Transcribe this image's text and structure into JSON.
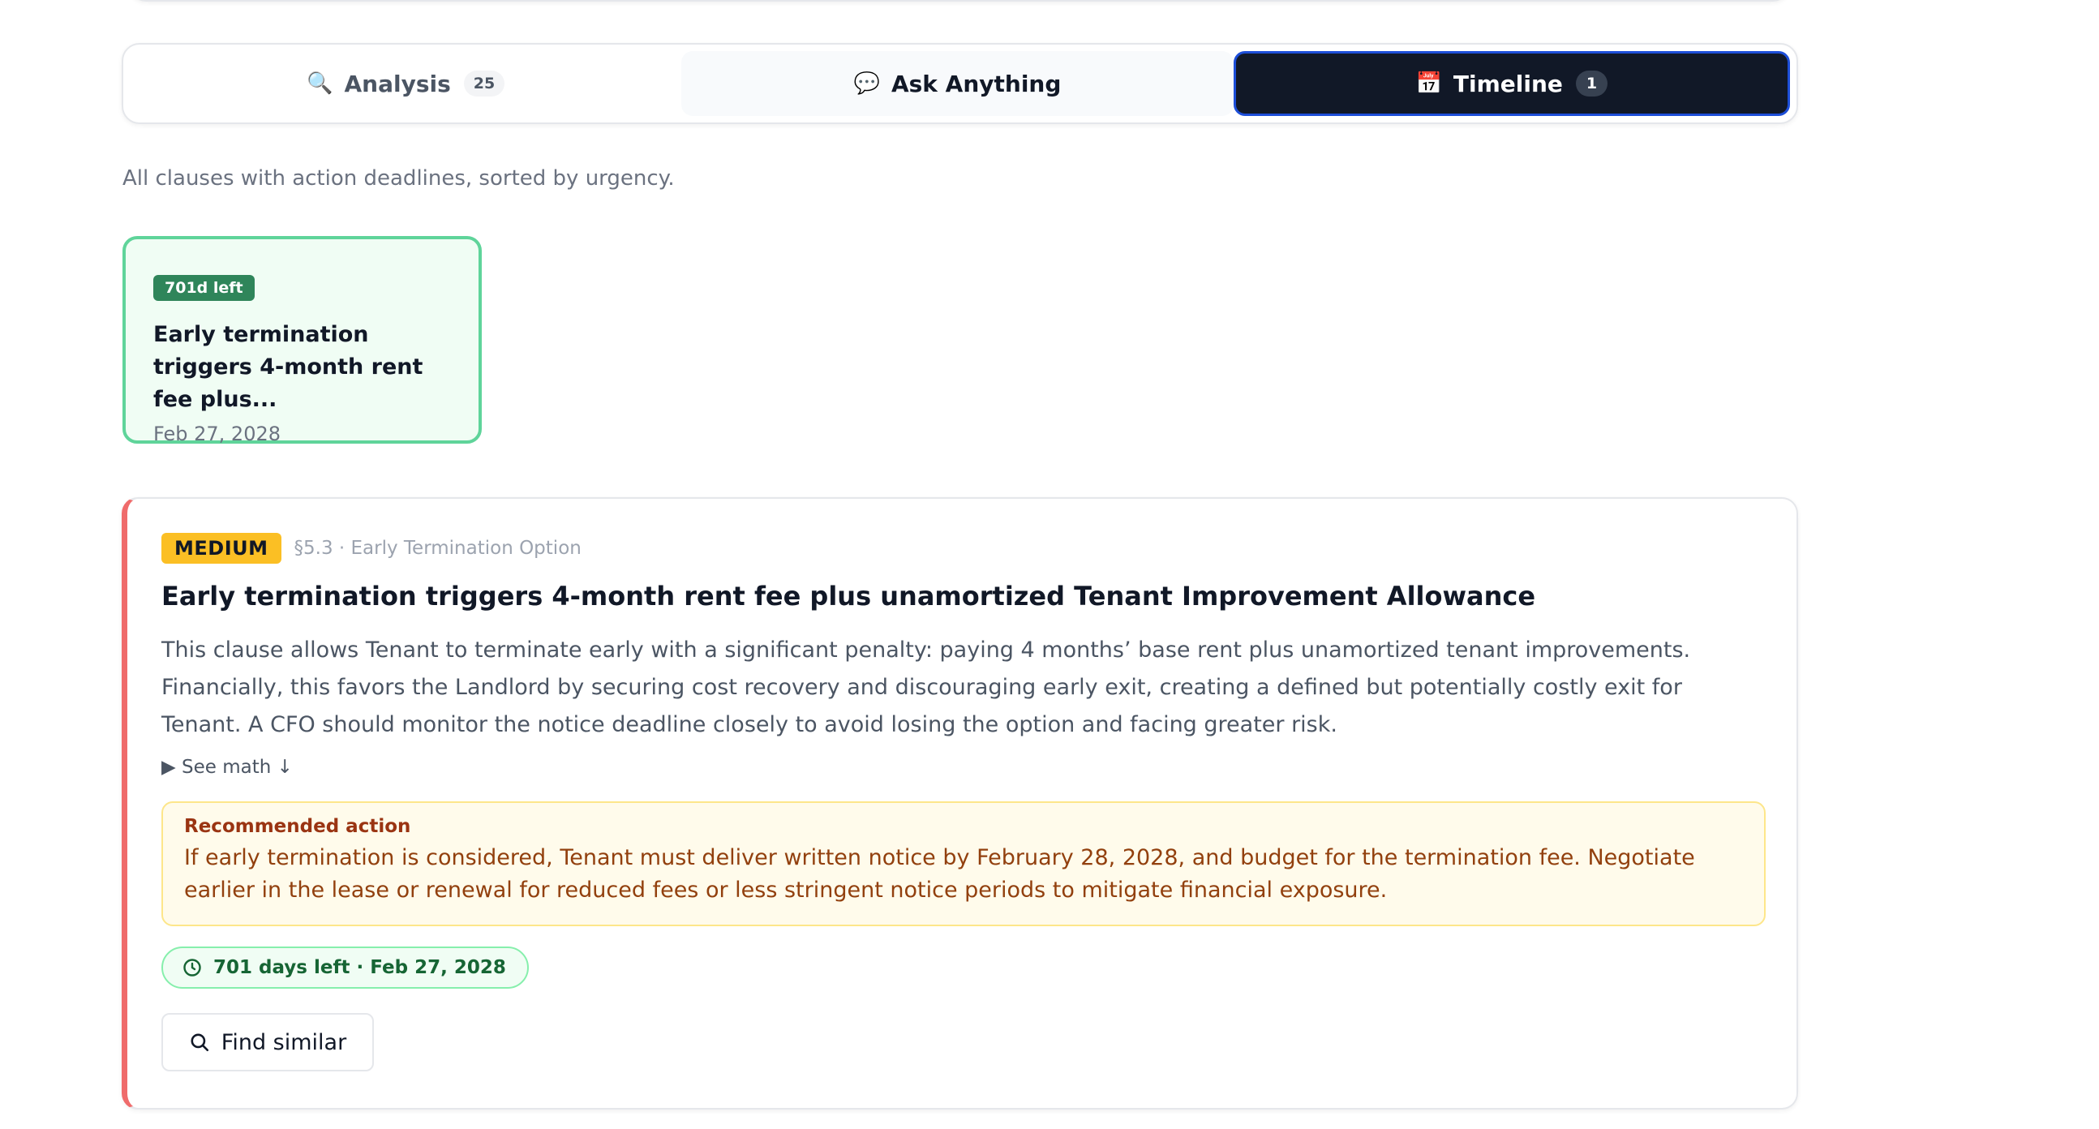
{
  "tabs": [
    {
      "label": "Analysis",
      "icon": "magnifier-icon",
      "count": "25"
    },
    {
      "label": "Ask Anything",
      "icon": "speech-bubble-icon"
    },
    {
      "label": "Timeline",
      "icon": "calendar-icon",
      "count": "1",
      "active": true
    }
  ],
  "subtitle": "All clauses with action deadlines, sorted by urgency.",
  "deadline_card": {
    "days_left": "701d left",
    "title": "Early termination triggers 4-month rent fee plus...",
    "date": "Feb 27, 2028"
  },
  "clause": {
    "severity": "MEDIUM",
    "section": "§5.3 · Early Termination Option",
    "title": "Early termination triggers 4-month rent fee plus unamortized Tenant Improvement Allowance",
    "body": "This clause allows Tenant to terminate early with a significant penalty: paying 4 months’ base rent plus unamortized tenant improvements. Financially, this favors the Landlord by securing cost recovery and discouraging early exit, creating a defined but potentially costly exit for Tenant. A CFO should monitor the notice deadline closely to avoid losing the option and facing greater risk.",
    "see_math": "▶ See math ↓",
    "recommended_label": "Recommended action",
    "recommended_text": "If early termination is considered, Tenant must deliver written notice by February 28, 2028, and budget for the termination fee. Negotiate earlier in the lease or renewal for reduced fees or less stringent notice periods to mitigate financial exposure.",
    "deadline_chip": "701 days left · Feb 27, 2028",
    "find_similar": "Find similar"
  },
  "colors": {
    "active_tab_bg": "#111827",
    "active_tab_border": "#1d4ed8",
    "severity_medium": "#fbbf24",
    "card_border_left": "#ef6b6b",
    "days_pill": "#2f855a",
    "recommended_bg": "#fffbeb"
  }
}
